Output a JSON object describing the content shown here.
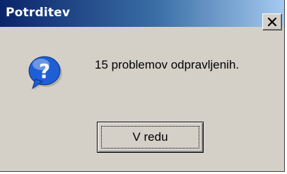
{
  "window": {
    "title": "Potrditev",
    "close_icon": "close-icon"
  },
  "dialog": {
    "icon": "question-icon",
    "message": "15 problemov odpravljenih."
  },
  "buttons": {
    "ok_label": "V redu"
  },
  "colors": {
    "title_bar_start": "#0a246a",
    "title_bar_end": "#a6caf0",
    "dialog_background": "#d4d0c8",
    "icon_bubble": "#1e5fd6"
  }
}
